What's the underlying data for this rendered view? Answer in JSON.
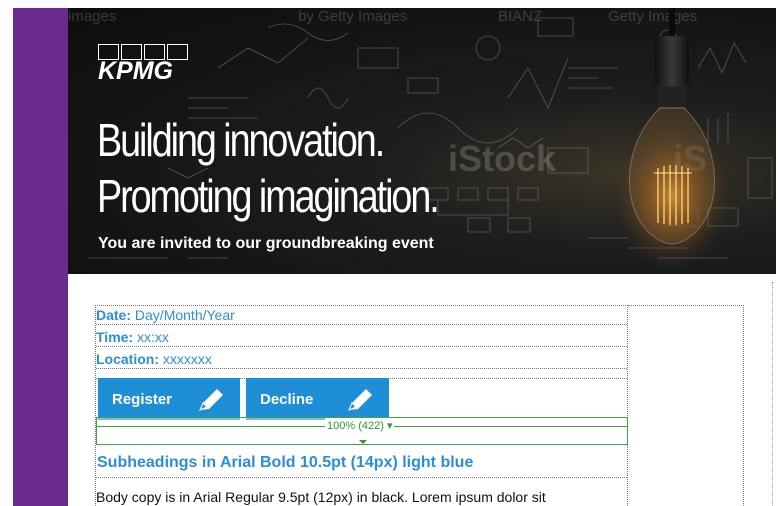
{
  "banner": {
    "logo_text": "KPMG",
    "headline_line1": "Building innovation.",
    "headline_line2": "Promoting imagination.",
    "invite": "You are invited to our groundbreaking event",
    "watermarks": [
      "images",
      "by Getty Images",
      "BIANZ",
      "Getty Images",
      "iStock",
      "iS"
    ]
  },
  "details": {
    "date_label": "Date:",
    "date_value": "Day/Month/Year",
    "time_label": "Time:",
    "time_value": "xx:xx",
    "location_label": "Location:",
    "location_value": "xxxxxxx"
  },
  "buttons": {
    "register_label": "Register",
    "decline_label": "Decline"
  },
  "zoom": {
    "label": "100% (422)"
  },
  "content": {
    "subheading": "Subheadings in Arial Bold 10.5pt (14px) light blue",
    "body": "Body copy is in Arial Regular 9.5pt (12px) in black. Lorem ipsum dolor sit"
  },
  "colors": {
    "purple_bar": "#6a2a8e",
    "link_blue": "#2a8fd6",
    "button_blue": "#1e8fd6",
    "zoom_green": "#3ea83e"
  }
}
